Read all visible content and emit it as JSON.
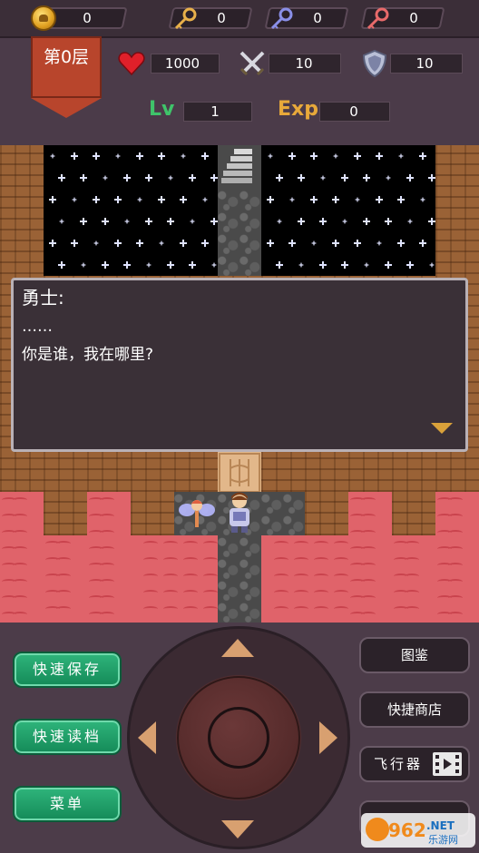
{
  "resources": {
    "gold": "0",
    "yellow_keys": "0",
    "blue_keys": "0",
    "red_keys": "0"
  },
  "hero": {
    "floor_label": "第0层",
    "hp": "1000",
    "attack": "10",
    "defense": "10",
    "lv_label": "Lv",
    "level": "1",
    "exp_label": "Exp",
    "exp": "0"
  },
  "dialog": {
    "speaker": "勇士:",
    "line1": "……",
    "line2": "你是谁，我在哪里?"
  },
  "buttons": {
    "quick_save": "快速保存",
    "quick_load": "快速读档",
    "menu": "菜单",
    "monster_book": "图鉴",
    "quick_shop": "快捷商店",
    "fly": "飞行器"
  },
  "watermark": {
    "brand": "962",
    "domain": ".NET",
    "caption": "乐游网"
  },
  "colors": {
    "panel": "#4b3b49",
    "lava": "#e0636a",
    "green_button": "#1f9e68",
    "floor_badge": "#b8452c",
    "arrow_color": "#d9a13a"
  },
  "icons": {
    "gold": "coin-icon",
    "yellow_key": "yellow-key-icon",
    "blue_key": "blue-key-icon",
    "red_key": "red-key-icon",
    "hp": "heart-icon",
    "attack": "crossed-swords-icon",
    "defense": "shield-icon",
    "fly": "film-icon"
  }
}
